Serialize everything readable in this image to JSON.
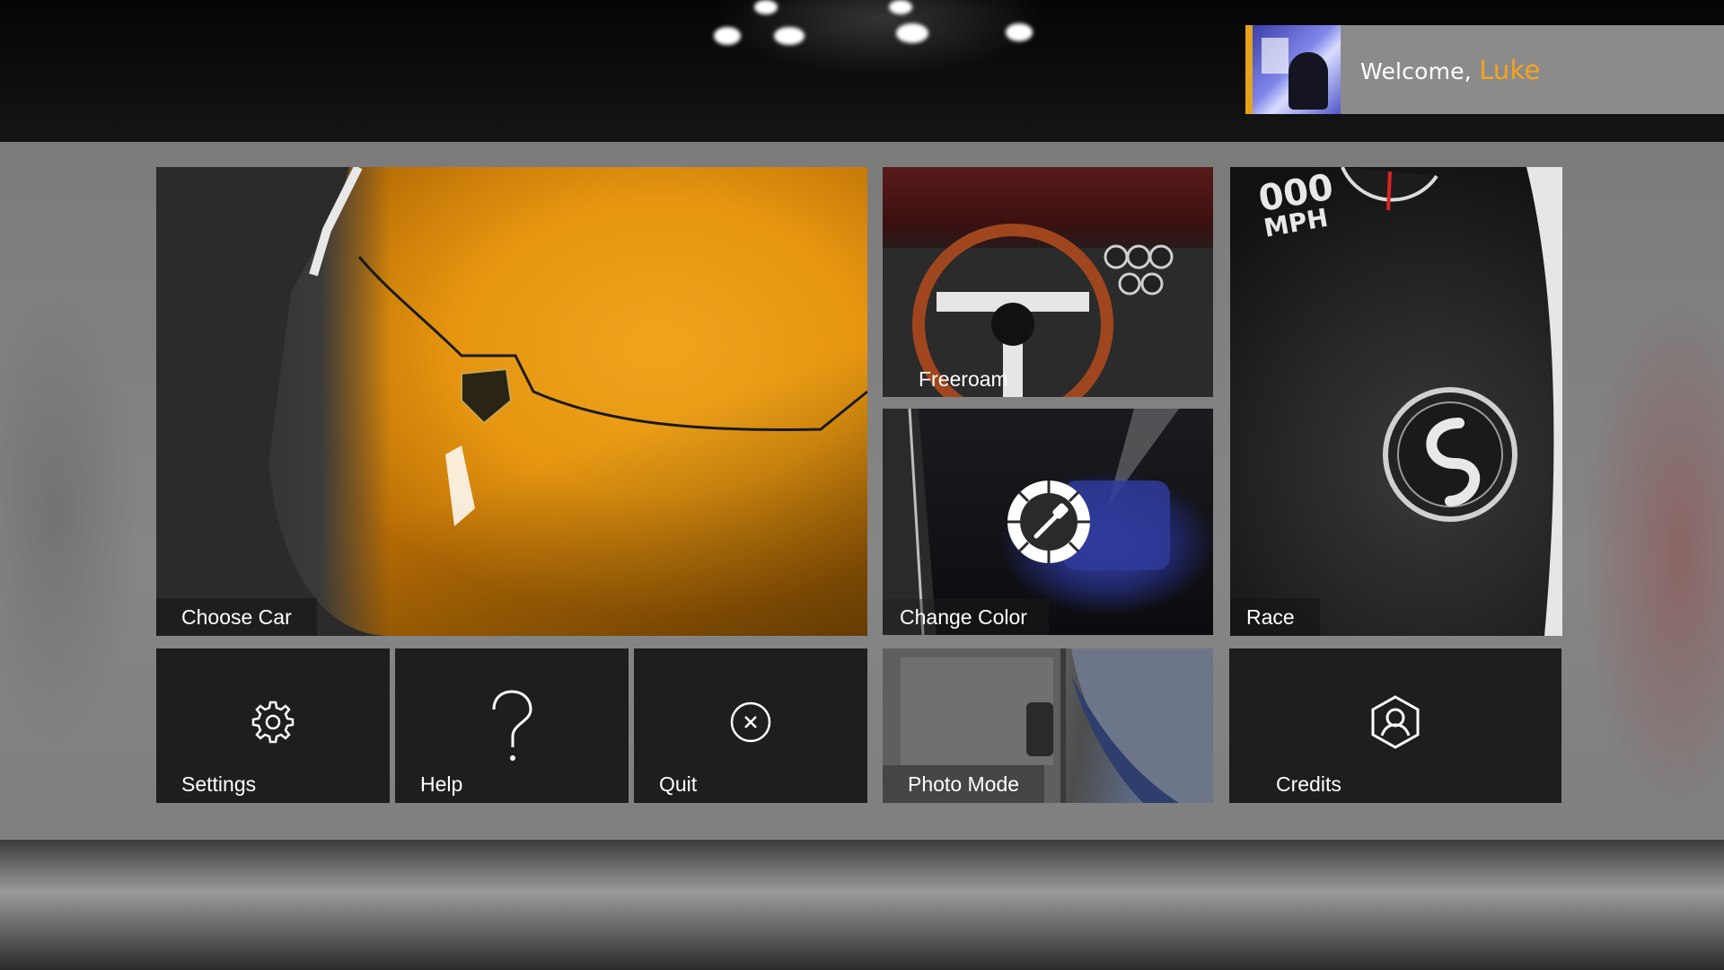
{
  "welcome": {
    "greeting": "Welcome,",
    "name": "Luke"
  },
  "tiles": {
    "choose_car": "Choose Car",
    "freeroam": "Freeroam",
    "change_color": "Change Color",
    "race": "Race",
    "settings": "Settings",
    "help": "Help",
    "quit": "Quit",
    "photo_mode": "Photo Mode",
    "credits": "Credits"
  },
  "scene_text": {
    "speedo_value": "000",
    "speedo_unit": "MPH"
  },
  "icons": {
    "settings": "gear-icon",
    "help": "question-mark-icon",
    "quit": "close-circle-icon",
    "credits": "user-hexagon-icon",
    "change_color": "color-picker-icon"
  },
  "colors": {
    "accent": "#F5A41D",
    "tile_dark": "#1E1E1E",
    "panel": "#818181"
  }
}
